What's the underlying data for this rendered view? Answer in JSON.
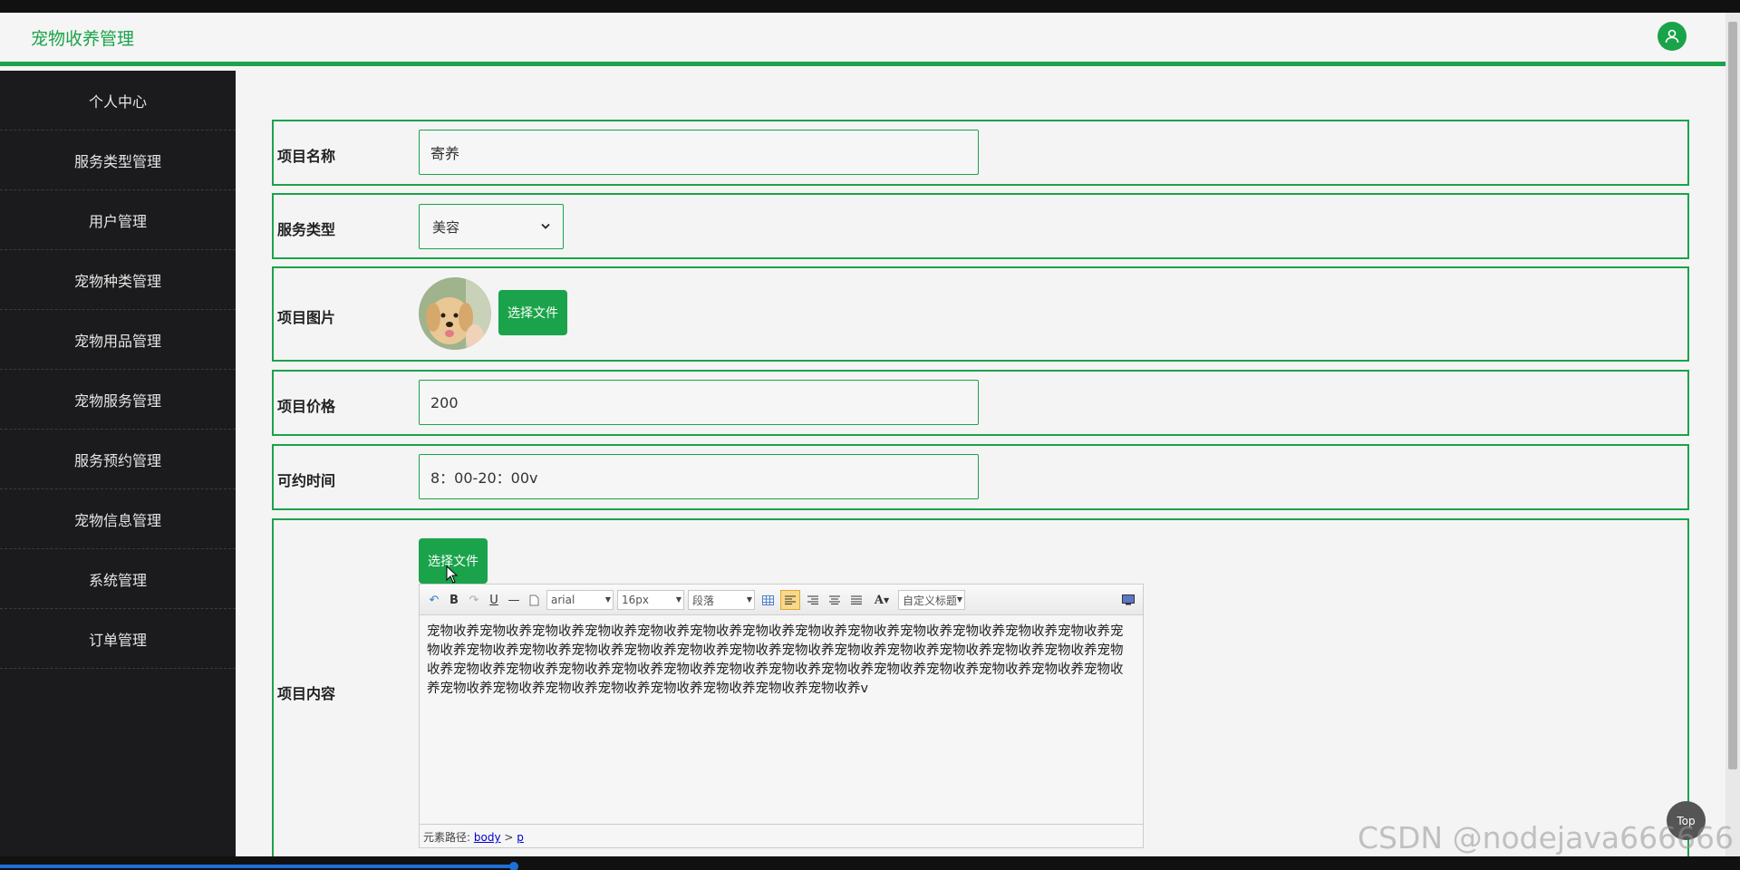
{
  "header": {
    "title": "宠物收养管理"
  },
  "sidebar": {
    "items": [
      {
        "label": "个人中心"
      },
      {
        "label": "服务类型管理"
      },
      {
        "label": "用户管理"
      },
      {
        "label": "宠物种类管理"
      },
      {
        "label": "宠物用品管理"
      },
      {
        "label": "宠物服务管理"
      },
      {
        "label": "服务预约管理"
      },
      {
        "label": "宠物信息管理"
      },
      {
        "label": "系统管理"
      },
      {
        "label": "订单管理"
      }
    ]
  },
  "form": {
    "name": {
      "label": "项目名称",
      "value": "寄养"
    },
    "service_type": {
      "label": "服务类型",
      "value": "美容"
    },
    "image": {
      "label": "项目图片",
      "button": "选择文件"
    },
    "price": {
      "label": "项目价格",
      "value": "200"
    },
    "time": {
      "label": "可约时间",
      "value": "8：00-20：00v"
    },
    "content": {
      "label": "项目内容",
      "upload_button": "选择文件",
      "text": "宠物收养宠物收养宠物收养宠物收养宠物收养宠物收养宠物收养宠物收养宠物收养宠物收养宠物收养宠物收养宠物收养宠物收养宠物收养宠物收养宠物收养宠物收养宠物收养宠物收养宠物收养宠物收养宠物收养宠物收养宠物收养宠物收养宠物收养宠物收养宠物收养宠物收养宠物收养宠物收养宠物收养宠物收养宠物收养宠物收养宠物收养宠物收养宠物收养宠物收养宠物收养宠物收养宠物收养宠物收养宠物收养宠物收养宠物收养宠物收养v",
      "toolbar": {
        "font": "arial",
        "size": "16px",
        "paragraph": "段落",
        "custom_title": "自定义标题"
      },
      "status": {
        "prefix": "元素路径:",
        "path1": "body",
        "sep": ">",
        "path2": "p"
      }
    }
  },
  "top_button": "Top",
  "watermark": "CSDN @nodejava666666"
}
